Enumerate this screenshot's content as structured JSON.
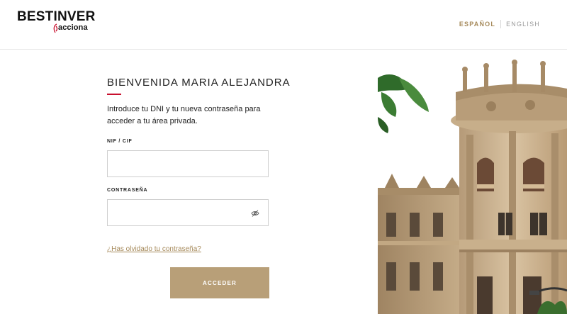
{
  "header": {
    "logo_main": "BESTINVER",
    "logo_sub": "acciona",
    "lang_es": "ESPAÑOL",
    "lang_en": "ENGLISH"
  },
  "form": {
    "title": "BIENVENIDA MARIA ALEJANDRA",
    "intro": "Introduce tu DNI y tu nueva contraseña para acceder a tu área privada.",
    "nif_label": "NIF / CIF",
    "nif_value": "",
    "password_label": "CONTRASEÑA",
    "password_value": "",
    "forgot_link": "¿Has olvidado tu contraseña?",
    "submit_label": "ACCEDER"
  },
  "colors": {
    "accent": "#a68a5b",
    "button": "#b89f78",
    "rule": "#c8102e"
  },
  "icons": {
    "password_toggle": "eye-slash-icon",
    "logo_mark": "acciona-mark-icon"
  }
}
